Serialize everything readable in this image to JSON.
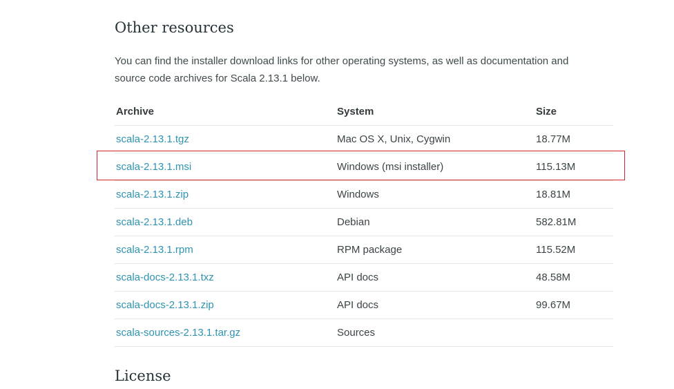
{
  "section": {
    "title": "Other resources",
    "intro": "You can find the installer download links for other operating systems, as well as documentation and source code archives for Scala 2.13.1 below."
  },
  "table": {
    "headers": {
      "archive": "Archive",
      "system": "System",
      "size": "Size"
    },
    "rows": [
      {
        "archive": "scala-2.13.1.tgz",
        "system": "Mac OS X, Unix, Cygwin",
        "size": "18.77M"
      },
      {
        "archive": "scala-2.13.1.msi",
        "system": "Windows (msi installer)",
        "size": "115.13M"
      },
      {
        "archive": "scala-2.13.1.zip",
        "system": "Windows",
        "size": "18.81M"
      },
      {
        "archive": "scala-2.13.1.deb",
        "system": "Debian",
        "size": "582.81M"
      },
      {
        "archive": "scala-2.13.1.rpm",
        "system": "RPM package",
        "size": "115.52M"
      },
      {
        "archive": "scala-docs-2.13.1.txz",
        "system": "API docs",
        "size": "48.58M"
      },
      {
        "archive": "scala-docs-2.13.1.zip",
        "system": "API docs",
        "size": "99.67M"
      },
      {
        "archive": "scala-sources-2.13.1.tar.gz",
        "system": "Sources",
        "size": ""
      }
    ]
  },
  "license": {
    "title": "License"
  },
  "colors": {
    "link": "#2e93b1",
    "highlight_border": "#d0262a",
    "row_divider": "#e6e8e8"
  }
}
